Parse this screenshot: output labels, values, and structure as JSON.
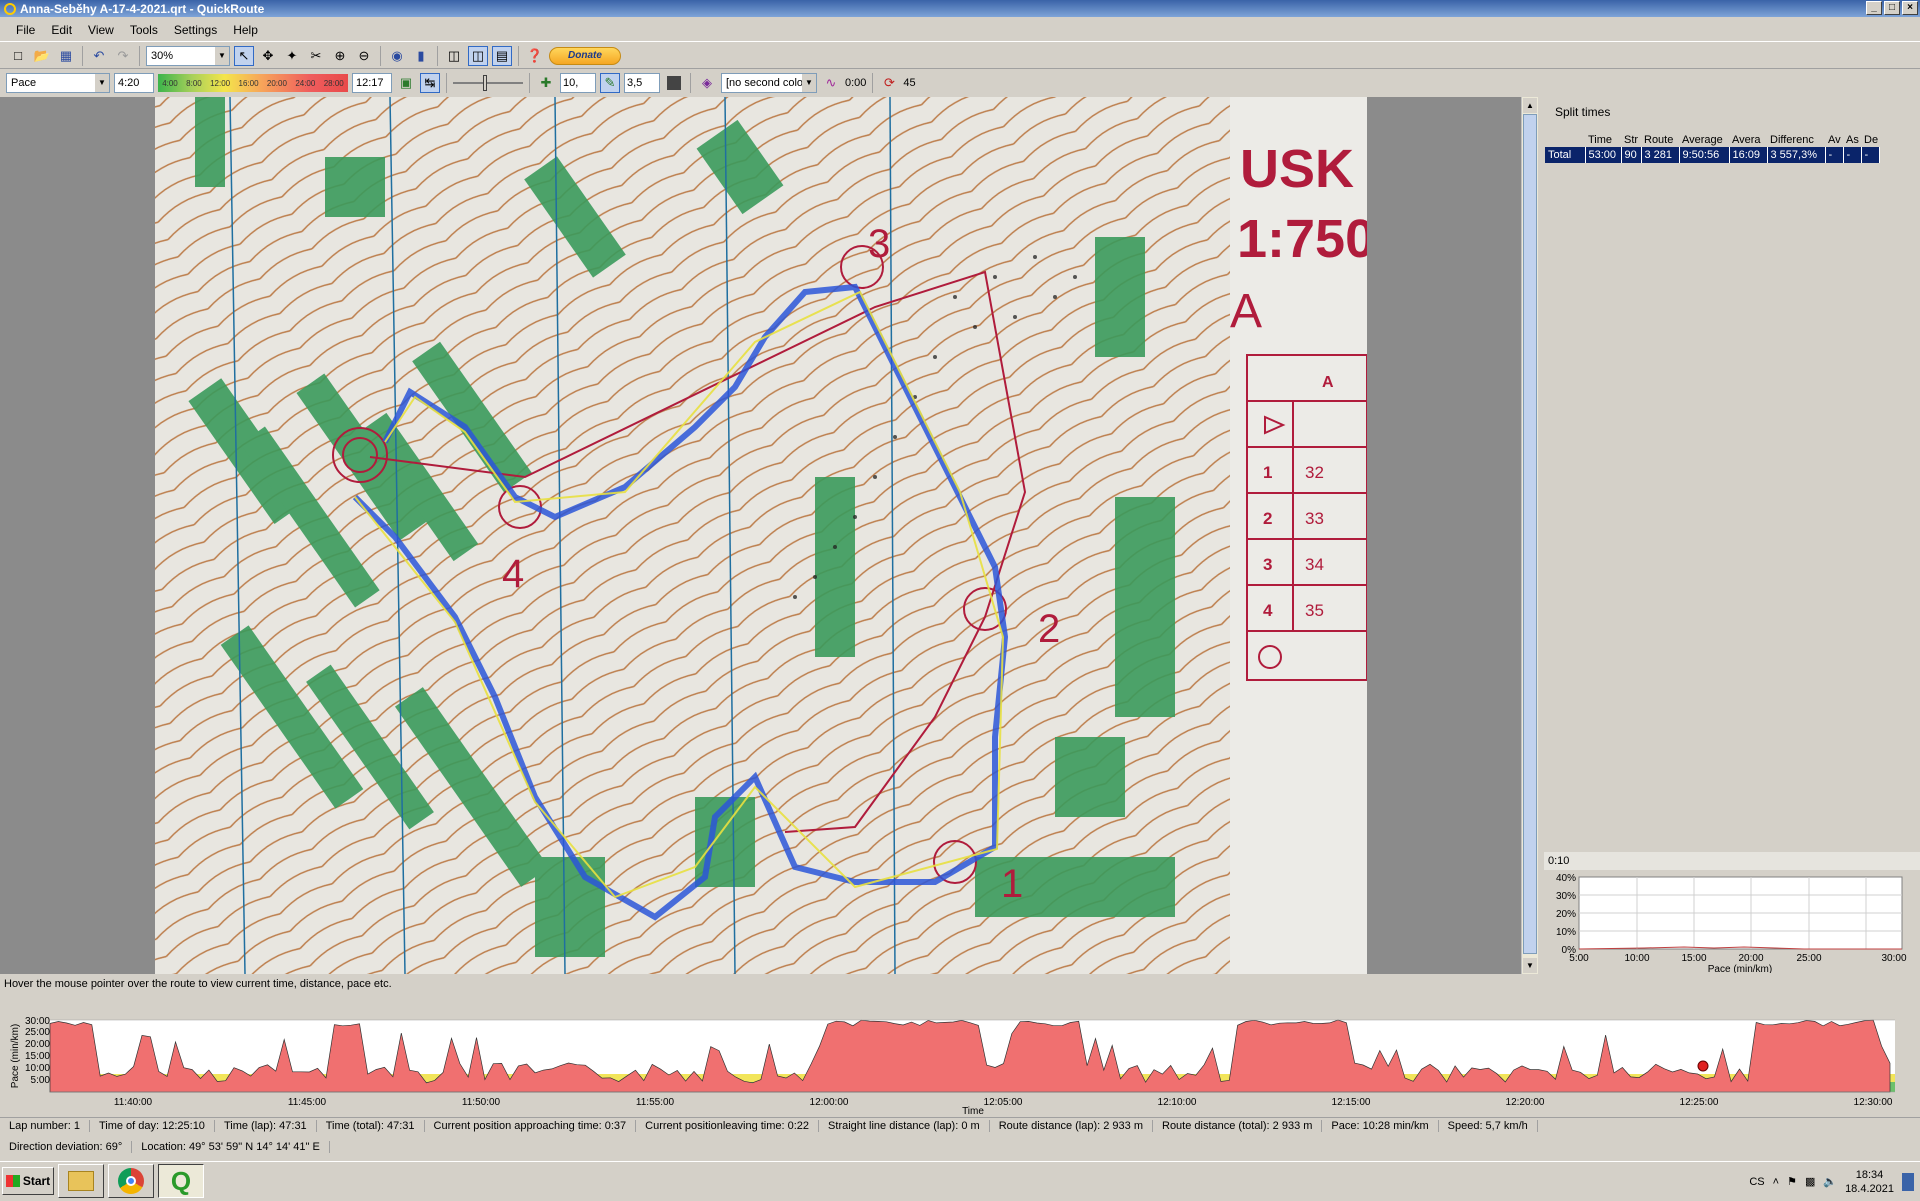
{
  "window": {
    "title": "Anna-Seběhy A-17-4-2021.qrt - QuickRoute",
    "min_label": "_",
    "max_label": "□",
    "close_label": "×"
  },
  "menu": [
    "File",
    "Edit",
    "View",
    "Tools",
    "Settings",
    "Help"
  ],
  "toolbar": {
    "zoom": "30%",
    "donate_label": "Donate",
    "icons": [
      "new-icon",
      "open-icon",
      "save-icon",
      "undo-icon",
      "redo-icon",
      "pointer-icon",
      "adjust-icon",
      "cut-icon",
      "zoom-in-icon",
      "zoom-out-icon",
      "map-icon",
      "split-icon",
      "layout-icon",
      "help-icon"
    ]
  },
  "toolbar2": {
    "color_coding": "Pace",
    "range_min": "4:20",
    "range_max": "12:17",
    "scale_ticks": [
      "4:00",
      "8:00",
      "12:00",
      "16:00",
      "20:00",
      "24:00",
      "28:00"
    ],
    "line_width": "10,",
    "smoothing": "3,5",
    "second_color": "[no second color",
    "time_offset": "0:00",
    "ignore_value": "45"
  },
  "map": {
    "title_text": "USK",
    "scale_text": "1:750",
    "course_letter": "A",
    "control_table_header": "A",
    "controls": [
      {
        "num": "1",
        "code": "32"
      },
      {
        "num": "2",
        "code": "33"
      },
      {
        "num": "3",
        "code": "34"
      },
      {
        "num": "4",
        "code": "35"
      }
    ],
    "map_labels": [
      "1",
      "2",
      "3",
      "4"
    ]
  },
  "splits": {
    "title": "Split times",
    "headers": [
      "Time",
      "Str",
      "Route",
      "Average",
      "Avera",
      "Differenc",
      "Av",
      "As",
      "De"
    ],
    "rows": [
      {
        "label": "Total",
        "cells": [
          "53:00",
          "90",
          "3 281",
          "9:50:56",
          "16:09",
          "3 557,3%",
          "-",
          "-",
          "-"
        ]
      }
    ]
  },
  "distribution": {
    "slider_value": "0:10",
    "y_ticks": [
      "40%",
      "30%",
      "20%",
      "10%",
      "0%"
    ],
    "x_ticks": [
      "5:00",
      "10:00",
      "15:00",
      "20:00",
      "25:00",
      "30:00"
    ],
    "xlabel": "Pace (min/km)"
  },
  "hint": "Hover the mouse pointer over the route to view current time, distance, pace etc.",
  "pace_graph": {
    "ylabel": "Pace (min/km)",
    "y_ticks": [
      "30:00",
      "25:00",
      "20:00",
      "15:00",
      "10:00",
      "5:00"
    ],
    "x_ticks": [
      "11:40:00",
      "11:45:00",
      "11:50:00",
      "11:55:00",
      "12:00:00",
      "12:05:00",
      "12:10:00",
      "12:15:00",
      "12:20:00",
      "12:25:00",
      "12:30:00"
    ],
    "xlabel": "Time"
  },
  "status": {
    "row1": [
      "Lap number: 1",
      "Time of day: 12:25:10",
      "Time (lap): 47:31",
      "Time (total): 47:31",
      "Current position approaching time: 0:37",
      "Current positionleaving time: 0:22",
      "Straight line distance (lap): 0 m",
      "Route distance (lap): 2 933 m",
      "Route distance (total): 2 933 m",
      "Pace: 10:28 min/km",
      "Speed: 5,7 km/h"
    ],
    "row2": [
      "Direction deviation: 69°",
      "Location: 49° 53' 59\" N   14° 14' 41\" E"
    ]
  },
  "taskbar": {
    "start_label": "Start",
    "language": "CS",
    "time": "18:34",
    "date": "18.4.2021"
  }
}
